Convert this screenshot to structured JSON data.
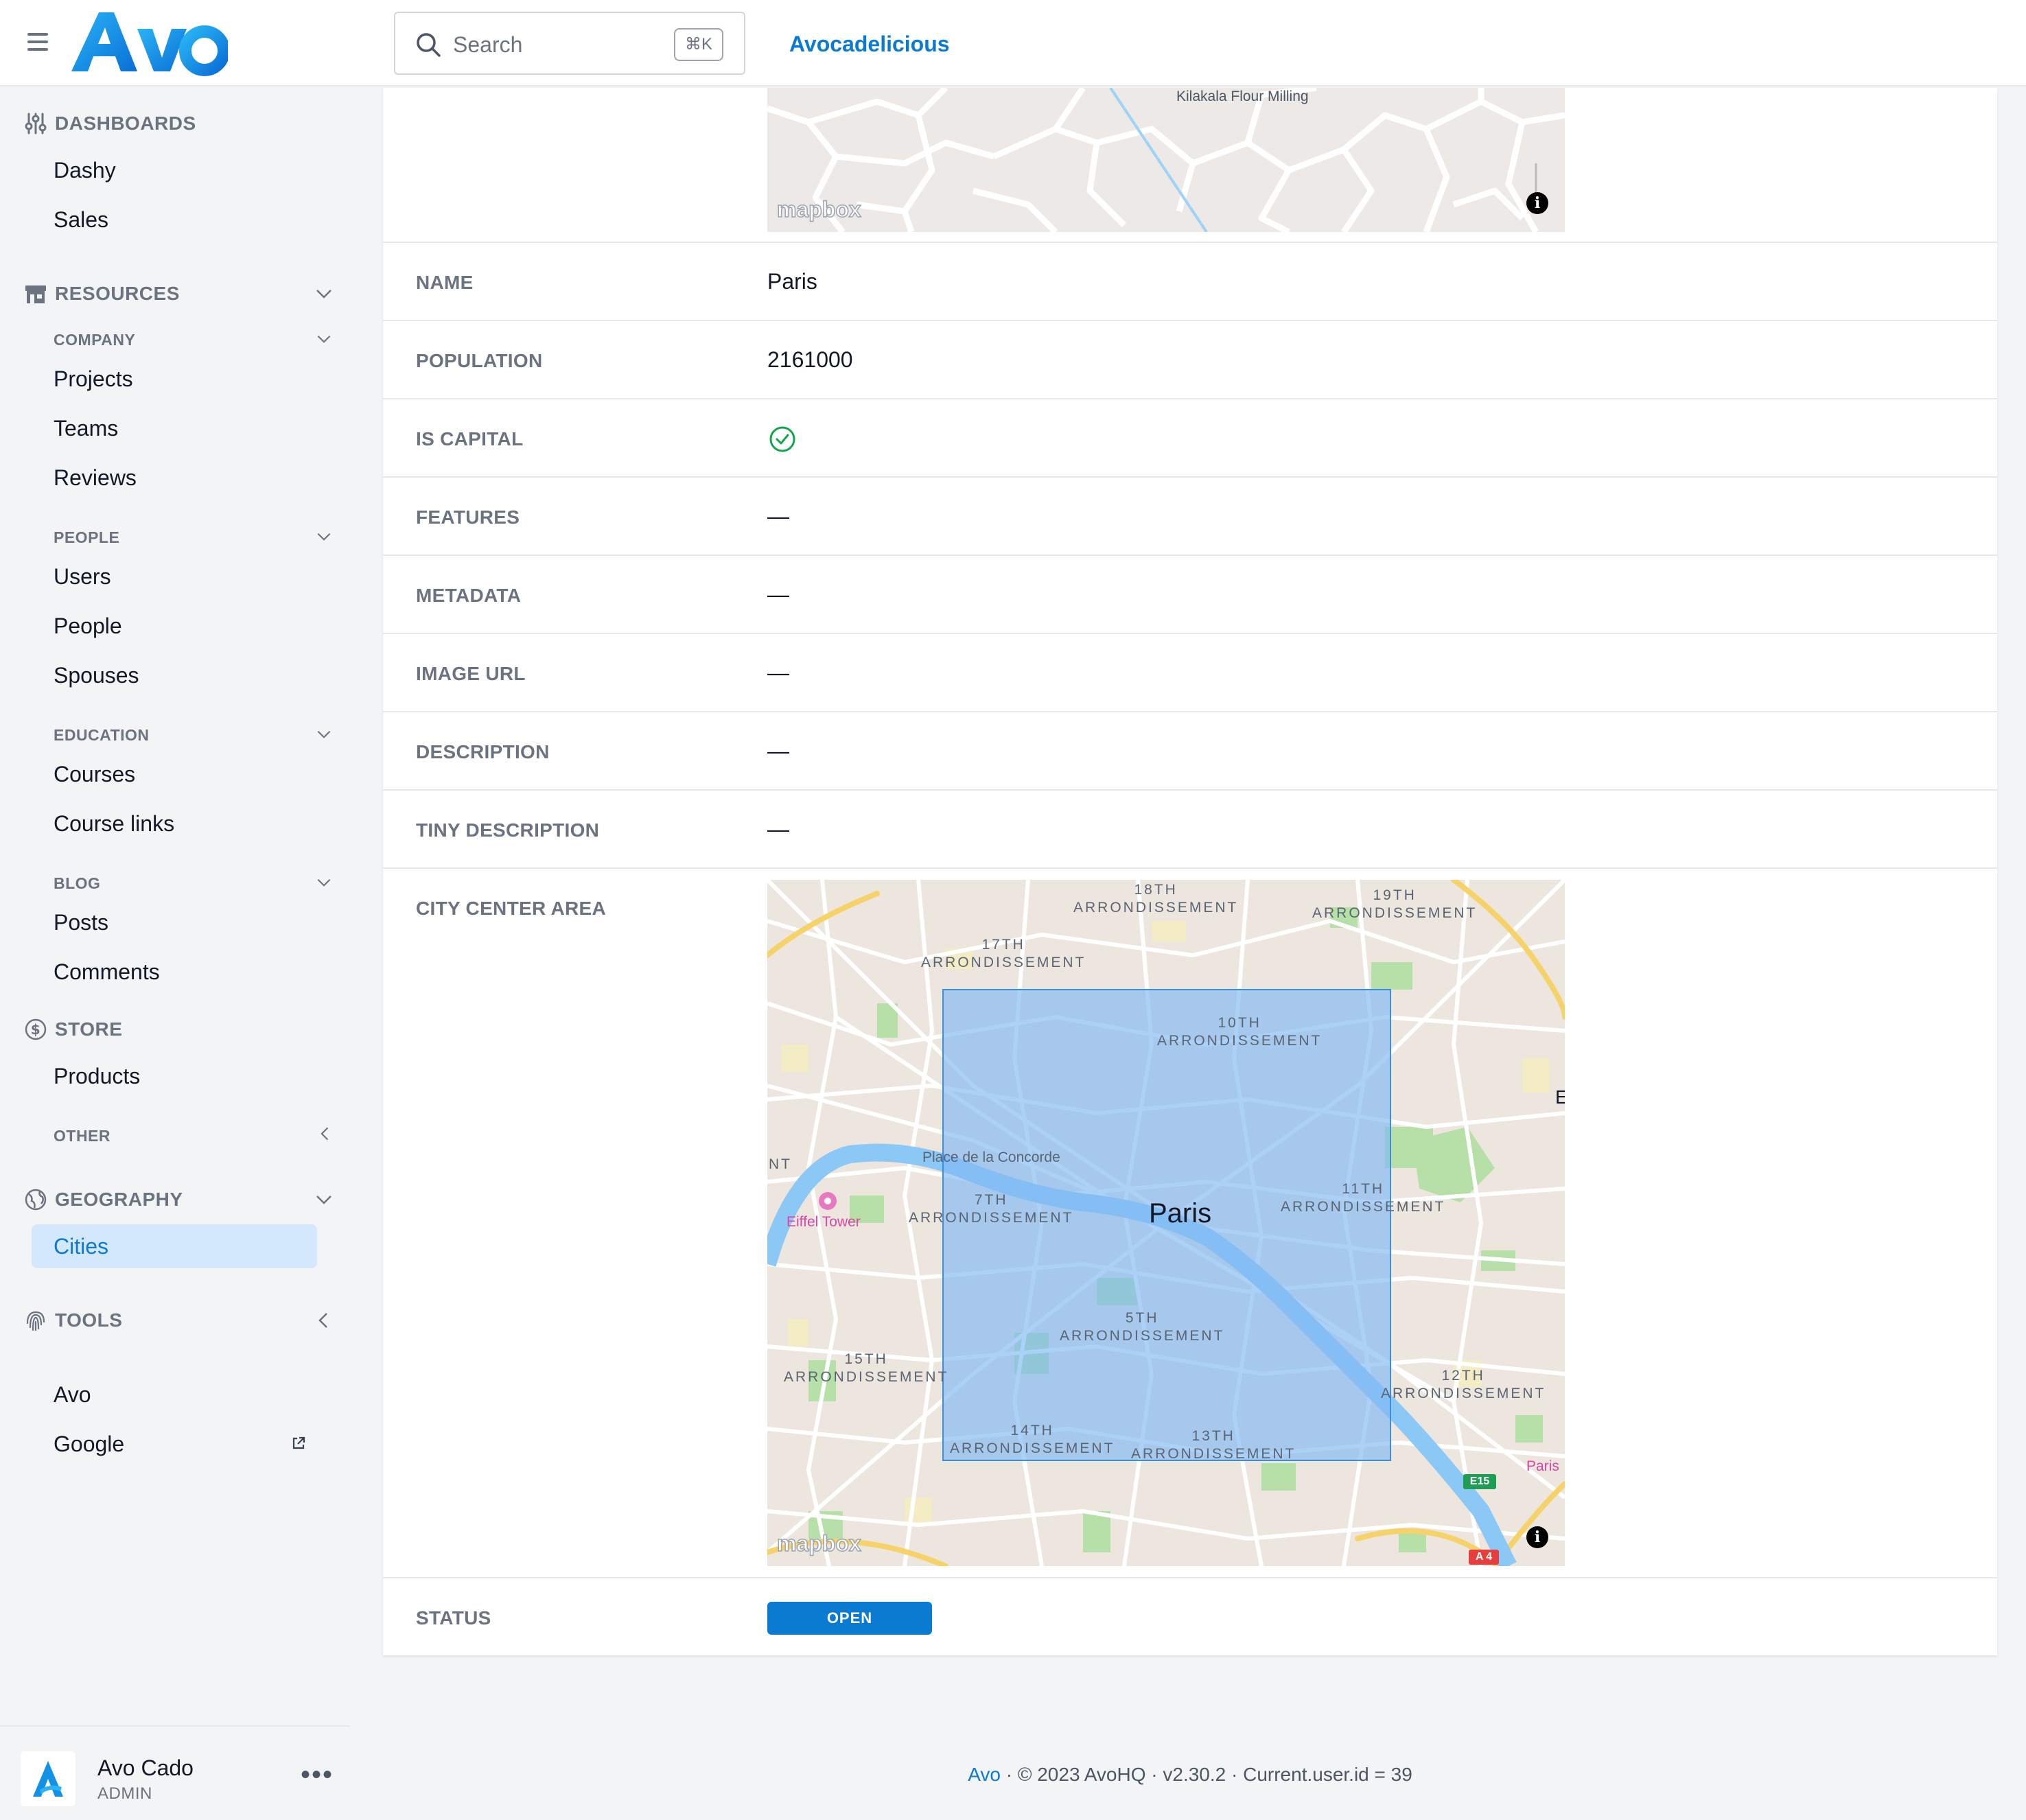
{
  "header": {
    "app_name": "Avocadelicious",
    "logo_text": "Avo",
    "search": {
      "placeholder": "Search",
      "shortcut": "⌘K"
    }
  },
  "sidebar": {
    "dashboards": {
      "title": "DASHBOARDS",
      "items": [
        "Dashy",
        "Sales"
      ]
    },
    "resources": {
      "title": "RESOURCES",
      "groups": [
        {
          "title": "COMPANY",
          "items": [
            "Projects",
            "Teams",
            "Reviews"
          ]
        },
        {
          "title": "PEOPLE",
          "items": [
            "Users",
            "People",
            "Spouses"
          ]
        },
        {
          "title": "EDUCATION",
          "items": [
            "Courses",
            "Course links"
          ]
        },
        {
          "title": "BLOG",
          "items": [
            "Posts",
            "Comments"
          ]
        }
      ]
    },
    "store": {
      "title": "STORE",
      "items": [
        "Products"
      ],
      "other": "OTHER"
    },
    "geography": {
      "title": "GEOGRAPHY",
      "active_item": "Cities"
    },
    "tools": {
      "title": "TOOLS",
      "items": [
        "Avo",
        "Google"
      ]
    }
  },
  "user": {
    "name": "Avo Cado",
    "role": "ADMIN",
    "menu": "•••"
  },
  "record": {
    "top_map": {
      "label_kilakala": "Kilakala Flour Milling",
      "brand": "mapbox",
      "info": "i"
    },
    "fields": [
      {
        "label": "NAME",
        "value": "Paris"
      },
      {
        "label": "POPULATION",
        "value": "2161000"
      },
      {
        "label": "IS CAPITAL",
        "value": ""
      },
      {
        "label": "FEATURES",
        "value": "—"
      },
      {
        "label": "METADATA",
        "value": "—"
      },
      {
        "label": "IMAGE URL",
        "value": "—"
      },
      {
        "label": "DESCRIPTION",
        "value": "—"
      },
      {
        "label": "TINY DESCRIPTION",
        "value": "—"
      }
    ],
    "city_center": {
      "label": "CITY CENTER AREA",
      "map_labels": {
        "a18": "18TH\nARRONDISSEMENT",
        "a19": "19TH\nARRONDISSEMENT",
        "a17": "17TH\nARRONDISSEMENT",
        "a10": "10TH\nARRONDISSEMENT",
        "concorde": "Place de la Concorde",
        "nt": "NT",
        "eiffel": "Eiffel Tower",
        "a7": "7TH\nARRONDISSEMENT",
        "city": "Paris",
        "a11": "11TH\nARRONDISSEMENT",
        "a5": "5TH\nARRONDISSEMENT",
        "a15": "15TH\nARRONDISSEMENT",
        "a12": "12TH\nARRONDISSEMENT",
        "a14": "14TH\nARRONDISSEMENT",
        "a13": "13TH\nARRONDISSEMENT",
        "e": "E",
        "paris_small": "Paris",
        "e15": "E15",
        "a4": "A 4"
      },
      "brand": "mapbox",
      "info": "i",
      "colors": {
        "area_fill": "#7fb8f2",
        "area_stroke": "#3b8fe0",
        "river": "#8cc8f5"
      }
    },
    "status": {
      "label": "STATUS",
      "value": "OPEN"
    }
  },
  "footer": {
    "brand": "Avo",
    "text": " · © 2023 AvoHQ · v2.30.2 · Current.user.id = 39"
  },
  "colors": {
    "accent": "#0b7ad1",
    "success": "#16a34a",
    "active_bg": "#d4e8fb"
  }
}
